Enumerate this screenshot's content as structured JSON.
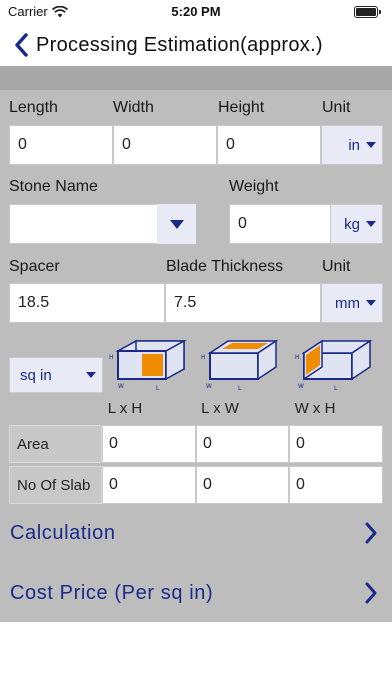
{
  "status": {
    "carrier": "Carrier",
    "time": "5:20 PM"
  },
  "nav": {
    "title": "Processing Estimation(approx.)",
    "back_icon": "chevron-left-icon"
  },
  "dimensions": {
    "length_label": "Length",
    "width_label": "Width",
    "height_label": "Height",
    "unit_label": "Unit",
    "length_value": "0",
    "width_value": "0",
    "height_value": "0",
    "unit_value": "in"
  },
  "stone": {
    "name_label": "Stone Name",
    "name_value": "",
    "weight_label": "Weight",
    "weight_value": "0",
    "weight_unit": "kg"
  },
  "spacer": {
    "spacer_label": "Spacer",
    "blade_label": "Blade Thickness",
    "unit_label": "Unit",
    "spacer_value": "18.5",
    "blade_value": "7.5",
    "unit_value": "mm"
  },
  "area_unit": "sq in",
  "diagram_labels": {
    "h": "H",
    "w": "W",
    "l": "L"
  },
  "columns": [
    "L x H",
    "L x W",
    "W x H"
  ],
  "rows": [
    {
      "label": "Area",
      "values": [
        "0",
        "0",
        "0"
      ]
    },
    {
      "label": "No Of Slab",
      "values": [
        "0",
        "0",
        "0"
      ]
    }
  ],
  "links": {
    "calculation": "Calculation",
    "cost_price": "Cost Price (Per sq in)"
  },
  "colors": {
    "accent": "#1a2a8a",
    "face": "#f08c00",
    "panel": "#bdbdbd"
  }
}
